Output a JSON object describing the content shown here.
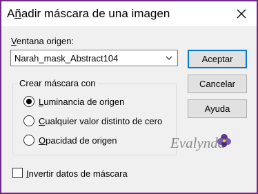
{
  "window": {
    "title_pre": "A",
    "title_ul": "ñ",
    "title_post": "adir máscara de una imagen",
    "close_icon": "close-icon",
    "border_color": "#6d2a86"
  },
  "source": {
    "label_ul": "V",
    "label_rest": "entana origen:",
    "selected": "Narah_mask_Abstract104"
  },
  "buttons": {
    "accept": "Aceptar",
    "cancel": "Cancelar",
    "help": "Ayuda"
  },
  "mask_group": {
    "legend": "Crear máscara con",
    "options": [
      {
        "ul": "L",
        "rest": "uminancia de origen",
        "checked": true
      },
      {
        "ul": "C",
        "rest": "ualquier valor distinto de cero",
        "checked": false
      },
      {
        "ul": "O",
        "rest": "pacidad de origen",
        "checked": false
      }
    ]
  },
  "invert": {
    "ul": "I",
    "rest": "nvertir datos de máscara",
    "checked": false
  },
  "watermark": {
    "text": "Evalynda"
  }
}
